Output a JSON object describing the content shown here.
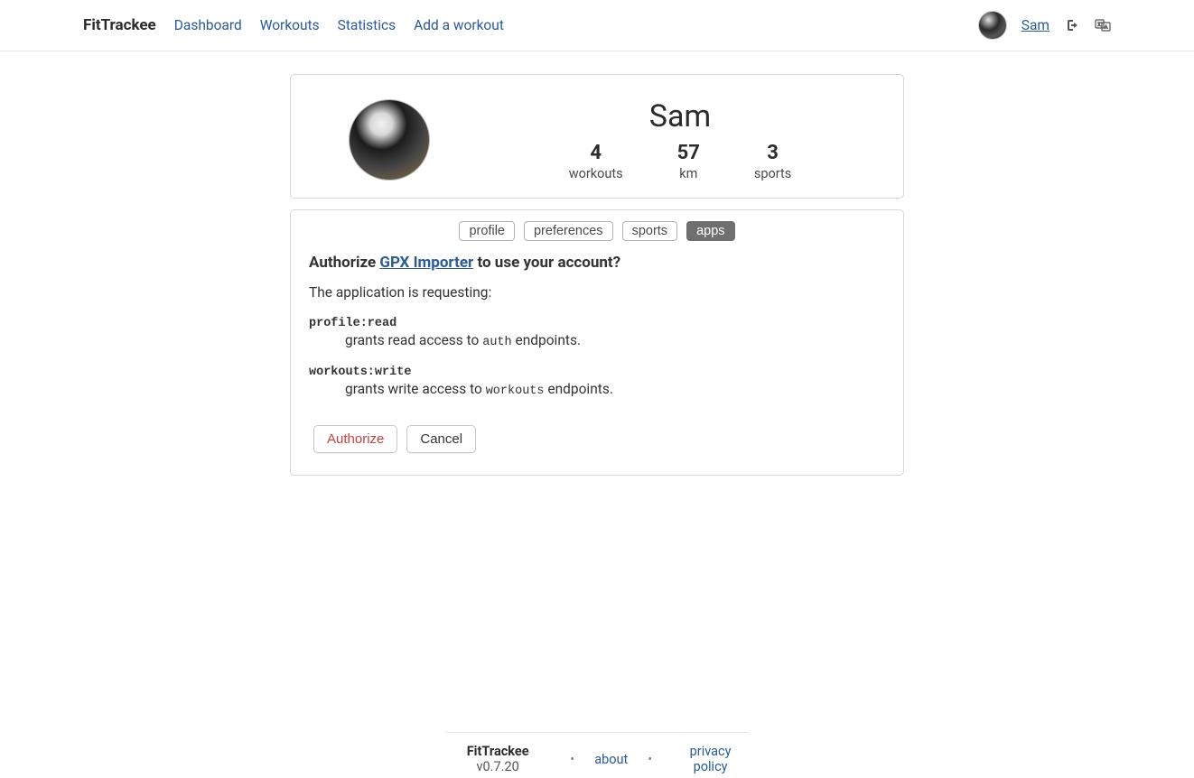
{
  "header": {
    "brand": "FitTrackee",
    "nav": [
      "Dashboard",
      "Workouts",
      "Statistics",
      "Add a workout"
    ],
    "username": "Sam"
  },
  "profile": {
    "name": "Sam",
    "stats": [
      {
        "value": "4",
        "label": "workouts"
      },
      {
        "value": "57",
        "label": "km"
      },
      {
        "value": "3",
        "label": "sports"
      }
    ]
  },
  "tabs": [
    {
      "label": "profile",
      "active": false
    },
    {
      "label": "preferences",
      "active": false
    },
    {
      "label": "sports",
      "active": false
    },
    {
      "label": "apps",
      "active": true
    }
  ],
  "authorize": {
    "prefix": "Authorize ",
    "app_name": "GPX Importer",
    "suffix": " to use your account?",
    "intro": "The application is requesting:",
    "scopes": [
      {
        "name": "profile:read",
        "desc_pre": "grants read access to ",
        "desc_code": "auth",
        "desc_post": " endpoints."
      },
      {
        "name": "workouts:write",
        "desc_pre": "grants write access to ",
        "desc_code": "workouts",
        "desc_post": " endpoints."
      }
    ],
    "authorize_btn": "Authorize",
    "cancel_btn": "Cancel"
  },
  "footer": {
    "brand": "FitTrackee",
    "version": " v0.7.20",
    "about": "about",
    "privacy": "privacy policy"
  }
}
